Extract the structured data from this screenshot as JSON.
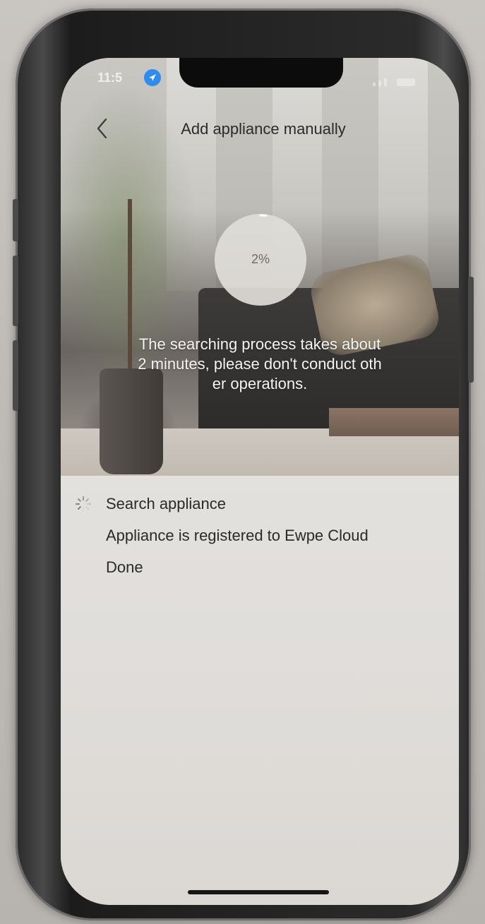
{
  "status_bar": {
    "time": "11:5"
  },
  "header": {
    "title": "Add appliance manually",
    "back_icon": "chevron-left-icon"
  },
  "progress": {
    "value": 2,
    "label": "2%"
  },
  "hint": {
    "lines": [
      "The searching process takes about",
      "2 minutes, please don't conduct oth",
      "er operations."
    ]
  },
  "steps": [
    {
      "label": "Search appliance",
      "state": "in-progress"
    },
    {
      "label": "Appliance is registered to Ewpe Cloud",
      "state": "pending"
    },
    {
      "label": "Done",
      "state": "pending"
    }
  ],
  "colors": {
    "accent_blue": "#2d8cf0",
    "progress_ring": "#ffffff",
    "text_dark": "#2a2a2a",
    "text_light": "#f5f4f2"
  }
}
